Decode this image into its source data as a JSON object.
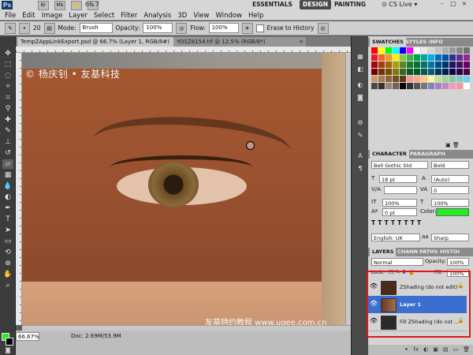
{
  "app": {
    "logo": "Ps",
    "zoom_top": "66.7",
    "menu": [
      "File",
      "Edit",
      "Image",
      "Layer",
      "Select",
      "Filter",
      "Analysis",
      "3D",
      "View",
      "Window",
      "Help"
    ],
    "workspaces": {
      "essentials": "ESSENTIALS",
      "design": "DESIGN",
      "painting": "PAINTING"
    },
    "cs_live": "CS Live",
    "window_buttons": [
      "–",
      "□",
      "×"
    ]
  },
  "options": {
    "brush_size": "20",
    "mode_label": "Mode:",
    "mode_value": "Brush",
    "opacity_label": "Opacity:",
    "opacity_value": "100%",
    "flow_label": "Flow:",
    "flow_value": "100%",
    "erase_history": "Erase to History"
  },
  "tabs": [
    {
      "label": "TempZAppLinkExport.psd @ 66.7% (Layer 1, RGB/8#)",
      "close": "×"
    },
    {
      "label": "YOSZ8154.tif @ 12.5% (RGB/8*)",
      "close": "×"
    }
  ],
  "canvas": {
    "watermark_top": "© 杨庆钊 • 友基科技",
    "watermark_bottom": "友基特约教程 www.ugee.com.cn"
  },
  "status": {
    "zoom": "66.67%",
    "doc": "Doc: 2.69M/53.9M"
  },
  "panels": {
    "swatch_tabs": [
      "SWATCHES",
      "STYLES",
      "INFO"
    ],
    "swatch_colors": [
      "#ff0000",
      "#ffff00",
      "#00ff00",
      "#00ffff",
      "#0000ff",
      "#ff00ff",
      "#ffffff",
      "#ebebeb",
      "#d6d6d6",
      "#c2c2c2",
      "#adadad",
      "#999999",
      "#858585",
      "#707070",
      "#ed1c24",
      "#f26522",
      "#f7941d",
      "#fff200",
      "#8dc63f",
      "#39b54a",
      "#00a651",
      "#00a99d",
      "#00aeef",
      "#0072bc",
      "#0054a6",
      "#2e3192",
      "#662d91",
      "#92278f",
      "#9e0b0f",
      "#a0410d",
      "#a36209",
      "#aba000",
      "#598527",
      "#1a7b30",
      "#007236",
      "#00746b",
      "#0076a3",
      "#004b80",
      "#003471",
      "#1b1464",
      "#440e62",
      "#630460",
      "#790000",
      "#7b2e00",
      "#7d4900",
      "#827b00",
      "#406618",
      "#005e20",
      "#005826",
      "#005952",
      "#005b7f",
      "#003663",
      "#002157",
      "#0d004c",
      "#32004b",
      "#4b0049",
      "#c69c6d",
      "#a67c52",
      "#8c6239",
      "#754c24",
      "#603913",
      "#f5989d",
      "#f9ad81",
      "#fdc68a",
      "#fff799",
      "#c4df9b",
      "#a3d39c",
      "#82ca9d",
      "#7accc8",
      "#6dcff6",
      "#534741",
      "#362f2d",
      "#998675",
      "#736357",
      "#000000",
      "#333333",
      "#555555",
      "#777777",
      "#8781bd",
      "#a186be",
      "#bd8cbf",
      "#f49ac1",
      "#f6989d",
      "#ffffff"
    ],
    "char_tabs": [
      "CHARACTER",
      "PARAGRAPH"
    ],
    "font_family": "Bell Gothic Std",
    "font_style": "Bold",
    "font_size": "18 pt",
    "leading": "(Auto)",
    "kerning": "",
    "tracking": "0",
    "vscale": "100%",
    "hscale": "100%",
    "baseline": "0 pt",
    "color_label": "Color:",
    "language": "English: UK",
    "aa": "Sharp",
    "aa_prefix": "aa",
    "layer_tabs": [
      "LAYERS",
      "CHANN",
      "PATHS",
      "HISTOI"
    ],
    "blend": "Normal",
    "layer_opacity_label": "Opacity:",
    "layer_opacity": "100%",
    "lock_label": "Lock:",
    "fill_label": "Fill:",
    "fill": "100%",
    "layers": [
      {
        "name": "ZShading (do not edit)",
        "selected": false,
        "thumb": "#4a2a1a"
      },
      {
        "name": "Layer 1",
        "selected": true,
        "thumb": "#8a5a3a"
      },
      {
        "name": "Fill ZShading (do not ...",
        "selected": false,
        "thumb": "#2a2a2a"
      }
    ],
    "layer_footer": [
      "fx",
      "◐",
      "▣",
      "▤",
      "▭",
      "🗑"
    ]
  },
  "highlight_color": "#e0161b"
}
